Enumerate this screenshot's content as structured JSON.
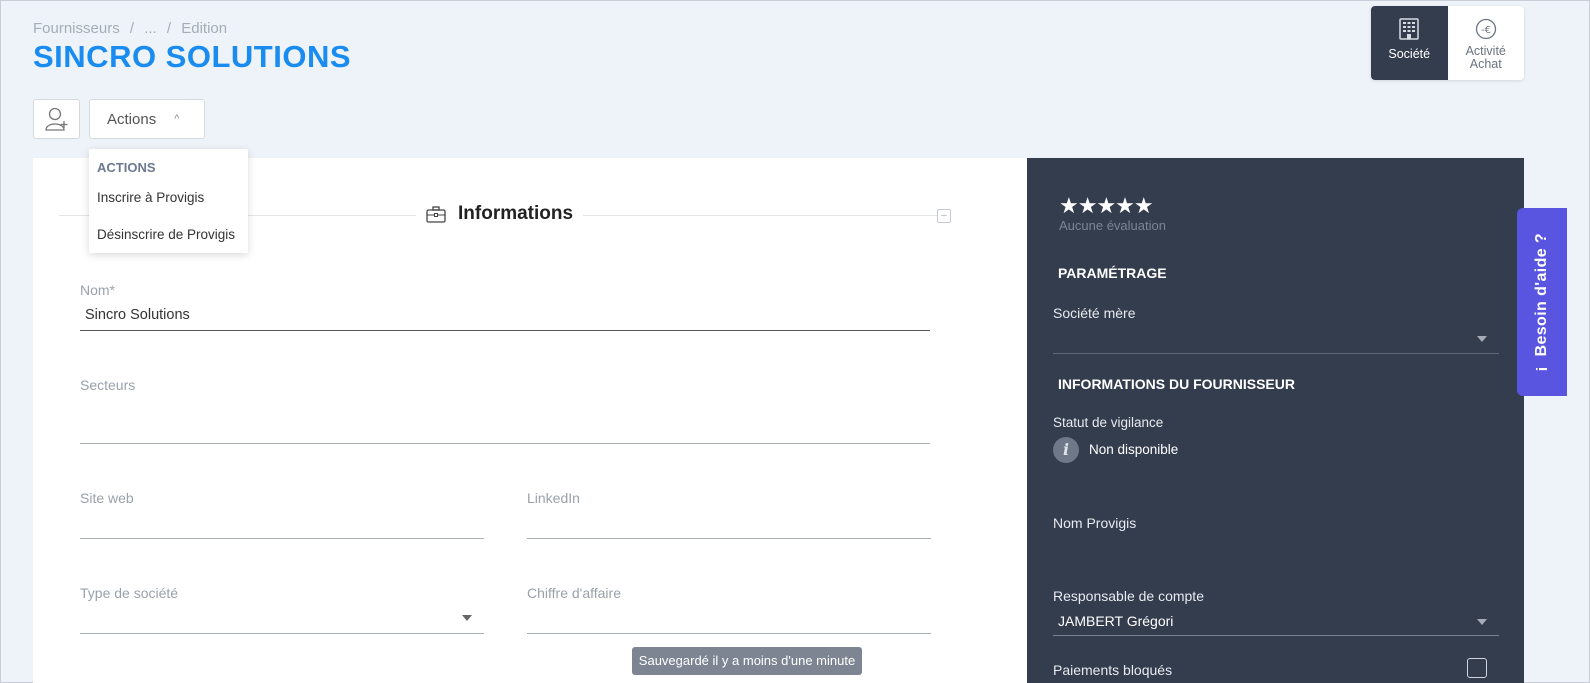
{
  "breadcrumb": {
    "items": [
      "Fournisseurs",
      "/",
      "...",
      "/",
      "Edition"
    ]
  },
  "page_title": "SINCRO SOLUTIONS",
  "top_tabs": [
    {
      "label": "Société",
      "icon": "building-icon",
      "active": true
    },
    {
      "label_line1": "Activité",
      "label_line2": "Achat",
      "icon": "euro-circle-icon",
      "active": false
    }
  ],
  "toolbar": {
    "actions_label": "Actions"
  },
  "actions_menu": {
    "header": "ACTIONS",
    "items": [
      "Inscrire à Provigis",
      "Désinscrire de Provigis"
    ]
  },
  "section": {
    "title": "Informations"
  },
  "form": {
    "nom_label": "Nom*",
    "nom_value": "Sincro Solutions",
    "secteurs_label": "Secteurs",
    "site_web_label": "Site web",
    "linkedin_label": "LinkedIn",
    "type_societe_label": "Type de société",
    "chiffre_affaire_label": "Chiffre d'affaire"
  },
  "toast": "Sauvegardé il y a moins d'une minute",
  "side_panel": {
    "stars": "★★★★★",
    "rating_text": "Aucune évaluation",
    "parametrage_heading": "PARAMÉTRAGE",
    "societe_mere_label": "Société mère",
    "fournisseur_heading": "INFORMATIONS DU FOURNISSEUR",
    "vigilance_label": "Statut de vigilance",
    "vigilance_value": "Non disponible",
    "nom_provigis_label": "Nom Provigis",
    "responsable_label": "Responsable de compte",
    "responsable_value": "JAMBERT Grégori",
    "paiements_label": "Paiements bloqués"
  },
  "help_tab": {
    "label": "Besoin d'aide ?",
    "icon_glyph": "i"
  }
}
